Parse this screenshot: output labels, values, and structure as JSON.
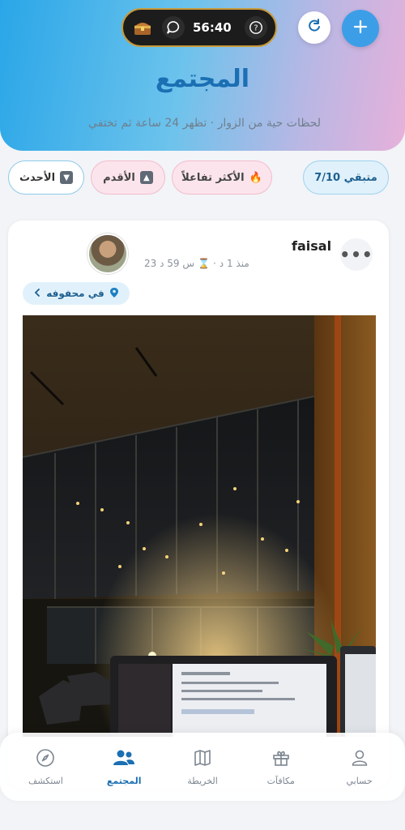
{
  "header": {
    "timer": "56:40",
    "title": "المجتمع",
    "subtitle": "لحظات حية من الزوار · تظهر 24 ساعة ثم تختفي"
  },
  "filters": {
    "remaining": "متبقي 7/10",
    "most_popular": "الأكثر تفاعلاً",
    "oldest": "الأقدم",
    "newest": "الأحدث"
  },
  "post": {
    "username": "faisal",
    "posted_ago": "منذ 1 د",
    "expires_in": "23 س 59 د",
    "location": "في محفوفه"
  },
  "nav": {
    "account": "حسابي",
    "rewards": "مكافآت",
    "map": "الخريطة",
    "community": "المجتمع",
    "explore": "استكشف"
  },
  "colors": {
    "accent": "#1b6fb3",
    "add_button": "#3d9ee8"
  },
  "icons": [
    "chest-icon",
    "chat-icon",
    "help-icon",
    "refresh-icon",
    "plus-icon",
    "fire-icon",
    "arrow-up-icon",
    "arrow-down-icon",
    "more-icon",
    "hourglass-icon",
    "location-pin-icon",
    "chevron-left-icon",
    "user-icon",
    "gift-icon",
    "map-icon",
    "people-icon",
    "compass-icon"
  ]
}
